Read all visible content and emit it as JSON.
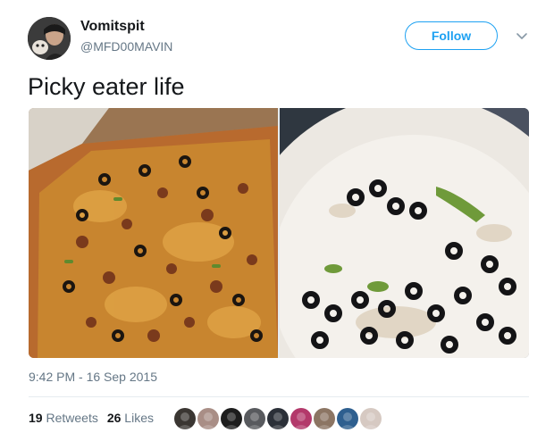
{
  "user": {
    "display_name": "Vomitspit",
    "handle": "@MFD00MAVIN",
    "avatar_icon": "user-avatar"
  },
  "follow_button": {
    "label": "Follow",
    "accent_color": "#1da1f2"
  },
  "menu": {
    "icon": "chevron-down-icon"
  },
  "tweet": {
    "text": "Picky eater life",
    "media": [
      {
        "kind": "photo",
        "subject": "pizza-in-box"
      },
      {
        "kind": "photo",
        "subject": "paper-plate-with-leftover-olives"
      }
    ],
    "timestamp": "9:42 PM - 16 Sep 2015"
  },
  "stats": {
    "retweets_count": "19",
    "retweets_label": "Retweets",
    "likes_count": "26",
    "likes_label": "Likes"
  },
  "likers": [
    {
      "color": "#3a3632"
    },
    {
      "color": "#a98e86"
    },
    {
      "color": "#1d1d1d"
    },
    {
      "color": "#585a5e"
    },
    {
      "color": "#2b3038"
    },
    {
      "color": "#b3396b"
    },
    {
      "color": "#8c7563"
    },
    {
      "color": "#2e5f8f"
    },
    {
      "color": "#d6c9c2"
    }
  ]
}
